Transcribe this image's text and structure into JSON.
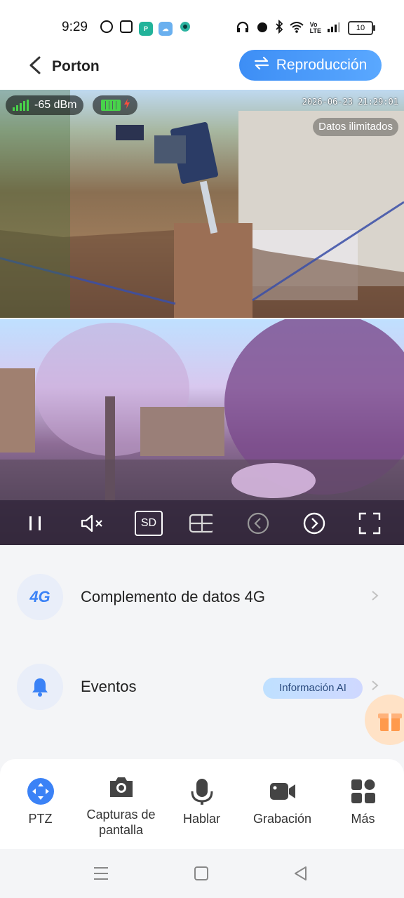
{
  "status_bar": {
    "time": "9:29",
    "battery": "10"
  },
  "header": {
    "title": "Porton",
    "replay_label": "Reproducción"
  },
  "camera": {
    "signal": "-65 dBm",
    "timestamp": "2026-06-23 21:29:01",
    "data_badge": "Datos ilimitados"
  },
  "controls": {
    "sd_label": "SD"
  },
  "list": {
    "row1_icon": "4G",
    "row1_label": "Complemento de datos 4G",
    "row2_label": "Eventos",
    "row2_badge": "Información AI"
  },
  "toolbar": {
    "ptz": "PTZ",
    "screenshots": "Capturas de pantalla",
    "talk": "Hablar",
    "record": "Grabación",
    "more": "Más"
  },
  "colors": {
    "accent": "#3d8ef5",
    "icon_blue": "#3b82f6",
    "signal_green": "#48d34a"
  }
}
